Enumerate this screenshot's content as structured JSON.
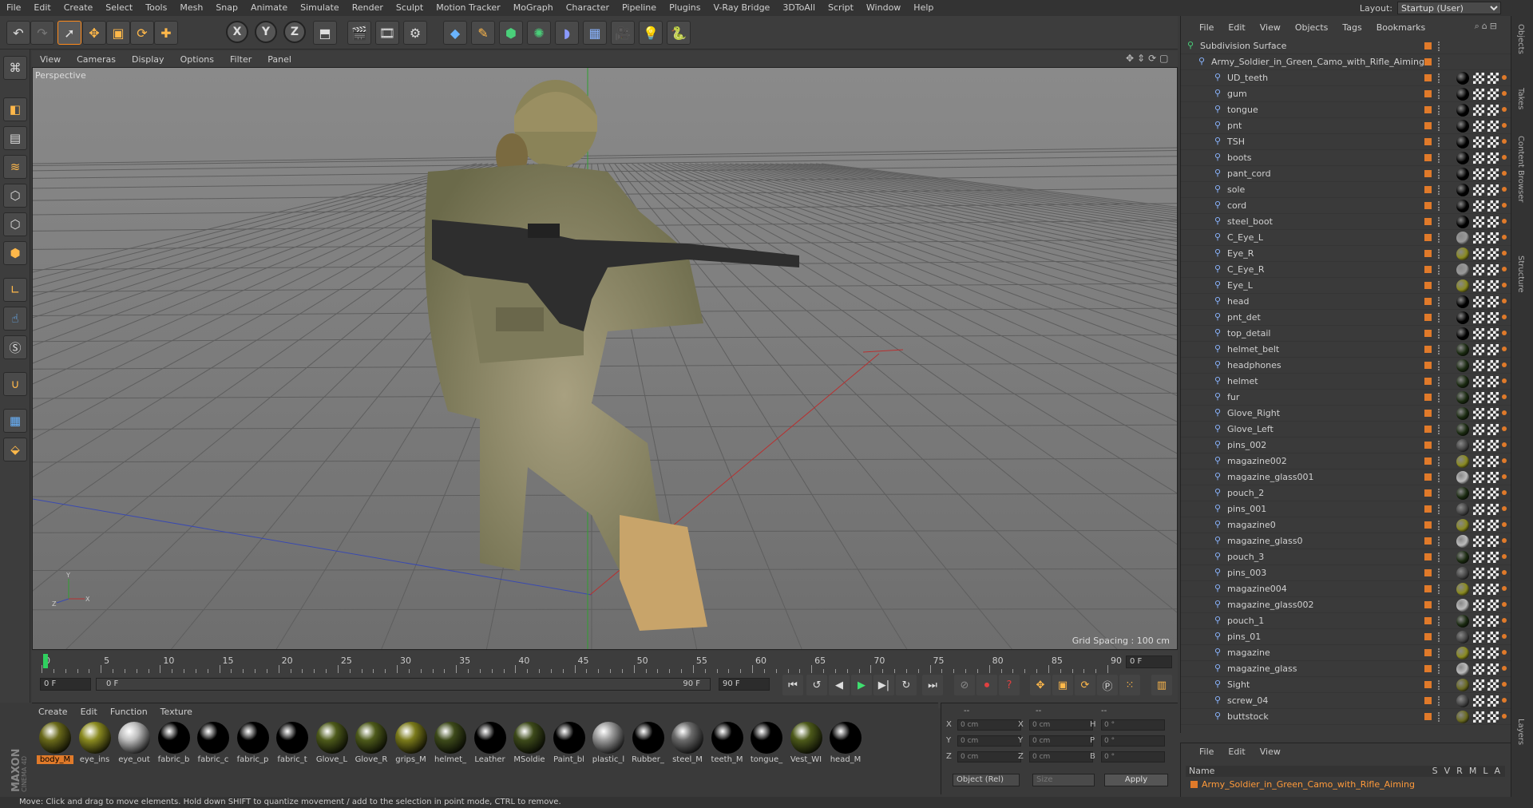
{
  "menubar": [
    "File",
    "Edit",
    "Create",
    "Select",
    "Tools",
    "Mesh",
    "Snap",
    "Animate",
    "Simulate",
    "Render",
    "Sculpt",
    "Motion Tracker",
    "MoGraph",
    "Character",
    "Pipeline",
    "Plugins",
    "V-Ray Bridge",
    "3DToAll",
    "Script",
    "Window",
    "Help"
  ],
  "layout": {
    "label": "Layout:",
    "value": "Startup (User)"
  },
  "viewport_menu": [
    "View",
    "Cameras",
    "Display",
    "Options",
    "Filter",
    "Panel"
  ],
  "viewport": {
    "label": "Perspective",
    "grid_spacing": "Grid Spacing : 100 cm"
  },
  "timeline": {
    "ticks": [
      "0",
      "5",
      "10",
      "15",
      "20",
      "25",
      "30",
      "35",
      "40",
      "45",
      "50",
      "55",
      "60",
      "65",
      "70",
      "75",
      "80",
      "85",
      "90"
    ],
    "current_frame": "0 F",
    "end_frame": "0 F",
    "start_field": "0 F",
    "range_start": "0 F",
    "range_end": "90 F",
    "max_field": "90 F"
  },
  "material_menu": [
    "Create",
    "Edit",
    "Function",
    "Texture"
  ],
  "materials": [
    {
      "name": "body_M",
      "color": "#6a6a1a",
      "selected": true
    },
    {
      "name": "eye_ins",
      "color": "#8a8a20"
    },
    {
      "name": "eye_out",
      "color": "#bdbdbd"
    },
    {
      "name": "fabric_b",
      "color": "#000000"
    },
    {
      "name": "fabric_c",
      "color": "#000000"
    },
    {
      "name": "fabric_p",
      "color": "#000000"
    },
    {
      "name": "fabric_t",
      "color": "#000000"
    },
    {
      "name": "Glove_L",
      "color": "#4d5a1a"
    },
    {
      "name": "Glove_R",
      "color": "#4d5a1a"
    },
    {
      "name": "grips_M",
      "color": "#7a7a1a"
    },
    {
      "name": "helmet_",
      "color": "#3d4a1a"
    },
    {
      "name": "Leather",
      "color": "#000000"
    },
    {
      "name": "MSoldie",
      "color": "#3d4a1a"
    },
    {
      "name": "Paint_bl",
      "color": "#000000"
    },
    {
      "name": "plastic_l",
      "color": "#9a9a9a"
    },
    {
      "name": "Rubber_",
      "color": "#000000"
    },
    {
      "name": "steel_M",
      "color": "#6a6a6a"
    },
    {
      "name": "teeth_M",
      "color": "#000000"
    },
    {
      "name": "tongue_",
      "color": "#000000"
    },
    {
      "name": "Vest_WI",
      "color": "#4d5a1a"
    },
    {
      "name": "head_M",
      "color": "#000000"
    }
  ],
  "coords": {
    "header": [
      "--",
      "--",
      "--"
    ],
    "rows": [
      {
        "a": "X",
        "av": "0 cm",
        "b": "X",
        "bv": "0 cm",
        "c": "H",
        "cv": "0 °"
      },
      {
        "a": "Y",
        "av": "0 cm",
        "b": "Y",
        "bv": "0 cm",
        "c": "P",
        "cv": "0 °"
      },
      {
        "a": "Z",
        "av": "0 cm",
        "b": "Z",
        "bv": "0 cm",
        "c": "B",
        "cv": "0 °"
      }
    ],
    "mode": "Object (Rel)",
    "size": "Size",
    "apply": "Apply"
  },
  "object_menu": [
    "File",
    "Edit",
    "View",
    "Objects",
    "Tags",
    "Bookmarks"
  ],
  "objects": {
    "root": "Subdivision Surface",
    "group": "Army_Soldier_in_Green_Camo_with_Rifle_Aiming",
    "children": [
      "UD_teeth",
      "gum",
      "tongue",
      "pnt",
      "TSH",
      "boots",
      "pant_cord",
      "sole",
      "cord",
      "steel_boot",
      "C_Eye_L",
      "Eye_R",
      "C_Eye_R",
      "Eye_L",
      "head",
      "pnt_det",
      "top_detail",
      "helmet_belt",
      "headphones",
      "helmet",
      "fur",
      "Glove_Right",
      "Glove_Left",
      "pins_002",
      "magazine002",
      "magazine_glass001",
      "pouch_2",
      "pins_001",
      "magazine0",
      "magazine_glass0",
      "pouch_3",
      "pins_003",
      "magazine004",
      "magazine_glass002",
      "pouch_1",
      "pins_01",
      "magazine",
      "magazine_glass",
      "Sight",
      "screw_04",
      "buttstock"
    ]
  },
  "attr_menu": [
    "File",
    "Edit",
    "View"
  ],
  "attr": {
    "name_label": "Name",
    "cols": [
      "S",
      "V",
      "R",
      "M",
      "L",
      "A"
    ],
    "item": "Army_Soldier_in_Green_Camo_with_Rifle_Aiming"
  },
  "side_tabs": [
    "Objects",
    "Takes",
    "Content Browser",
    "Structure",
    "Layers"
  ],
  "status": "Move: Click and drag to move elements. Hold down SHIFT to quantize movement / add to the selection in point mode, CTRL to remove.",
  "brand": "MAXON CINEMA 4D",
  "colors": {
    "accent": "#ff8a1a",
    "selection": "#e07a2a",
    "x_axis": "#c03030",
    "z_axis": "#3030c0",
    "y_axis": "#30a030"
  }
}
